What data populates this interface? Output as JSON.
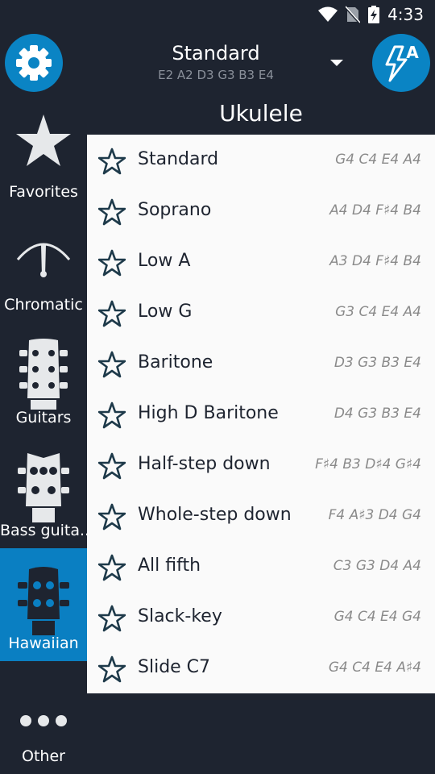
{
  "status": {
    "time": "4:33"
  },
  "header": {
    "tuning_name": "Standard",
    "tuning_notes": "E2 A2 D3 G3 B3 E4",
    "tuner_letter": "A"
  },
  "instrument_title": "Ukulele",
  "sidebar": {
    "items": [
      {
        "label": "Favorites",
        "icon": "star-icon",
        "active": false
      },
      {
        "label": "Chromatic",
        "icon": "chromatic-gauge-icon",
        "active": false
      },
      {
        "label": "Guitars",
        "icon": "guitar-headstock-icon",
        "active": false
      },
      {
        "label": "Bass guita...",
        "icon": "bass-headstock-icon",
        "active": false
      },
      {
        "label": "Hawaiian",
        "icon": "ukulele-headstock-icon",
        "active": true
      },
      {
        "label": "Other",
        "icon": "more-dots-icon",
        "active": false
      }
    ]
  },
  "tunings": [
    {
      "name": "Standard",
      "notes": "G4 C4 E4 A4"
    },
    {
      "name": "Soprano",
      "notes": "A4 D4 F♯4 B4"
    },
    {
      "name": "Low A",
      "notes": "A3 D4 F♯4 B4"
    },
    {
      "name": "Low G",
      "notes": "G3 C4 E4 A4"
    },
    {
      "name": "Baritone",
      "notes": "D3 G3 B3 E4"
    },
    {
      "name": "High D Baritone",
      "notes": "D4 G3 B3 E4"
    },
    {
      "name": "Half-step down",
      "notes": "F♯4 B3 D♯4 G♯4"
    },
    {
      "name": "Whole-step down",
      "notes": "F4 A♯3 D4 G4"
    },
    {
      "name": "All fifth",
      "notes": "C3 G3 D4 A4"
    },
    {
      "name": "Slack-key",
      "notes": "G4 C4 E4 G4"
    },
    {
      "name": "Slide C7",
      "notes": "G4 C4 E4 A♯4"
    }
  ],
  "colors": {
    "background": "#1e2430",
    "accent": "#0a84c4",
    "list_bg": "#fafafa"
  }
}
